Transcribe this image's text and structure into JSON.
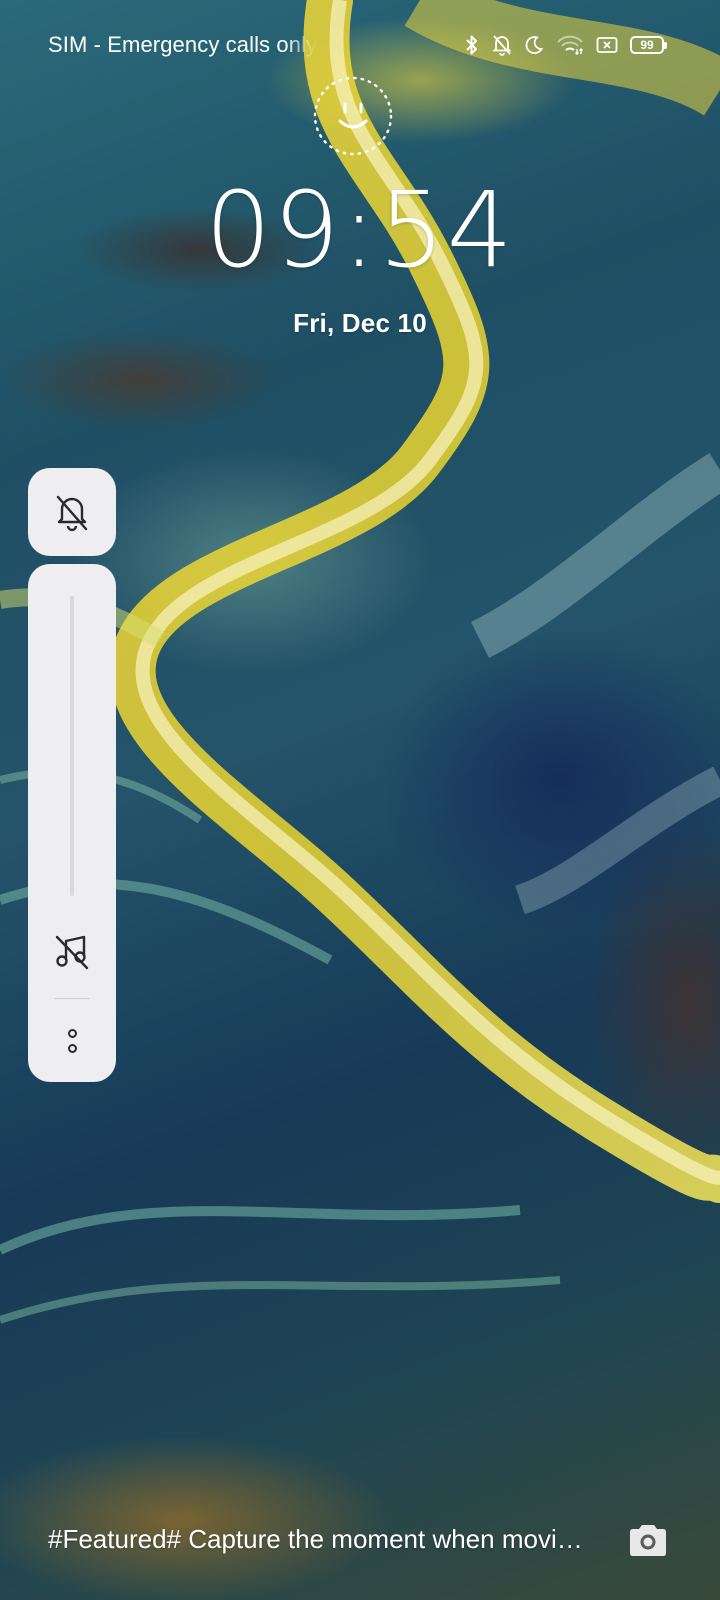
{
  "status_bar": {
    "carrier_text": "SIM - Emergency calls only",
    "battery_level": "99",
    "icons": [
      "bluetooth-icon",
      "bell-off-icon",
      "moon-icon",
      "wifi-icon",
      "sim-icon",
      "battery-icon"
    ]
  },
  "lock_screen": {
    "time": "09:54",
    "date": "Fri, Dec 10"
  },
  "volume_panel": {
    "ring_mode_icon": "bell-off-icon",
    "media_icon": "music-off-icon",
    "media_volume_fraction": 0,
    "more_icon": "more-options-icon"
  },
  "footer": {
    "caption": "#Featured# Capture the moment when moving water",
    "camera_icon": "camera-icon"
  },
  "colors": {
    "panel_bg": "#eeeef0",
    "icon_dark": "#2a2a2a",
    "text": "#ffffff"
  }
}
